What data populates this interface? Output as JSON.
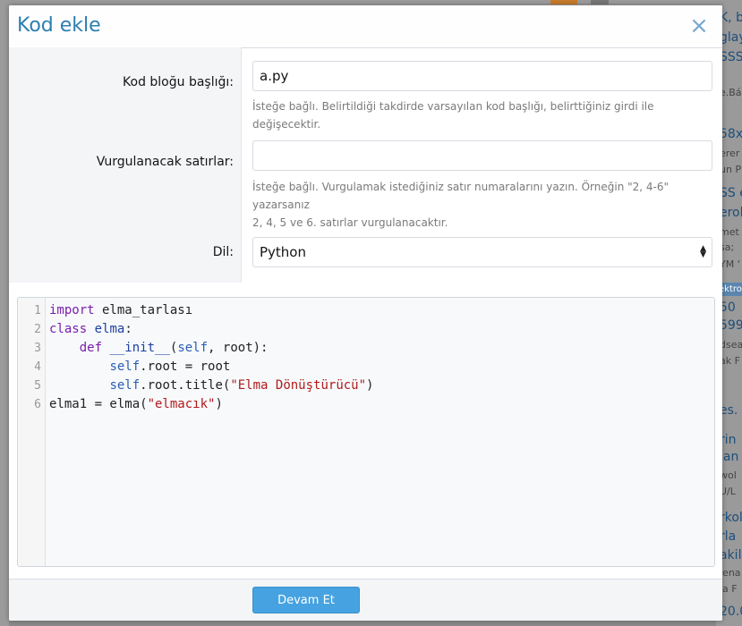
{
  "modal": {
    "title": "Kod ekle",
    "close_symbol": "×"
  },
  "form": {
    "title_label": "Kod bloğu başlığı:",
    "title_value": "a.py",
    "title_hint": "İsteğe bağlı. Belirtildiği takdirde varsayılan kod başlığı, belirttiğiniz girdi ile değişecektir.",
    "highlight_label": "Vurgulanacak satırlar:",
    "highlight_value": "",
    "highlight_hint_1": "İsteğe bağlı. Vurgulamak istediğiniz satır numaralarını yazın. Örneğin \"2, 4-6\" yazarsanız",
    "highlight_hint_2": "2, 4, 5 ve 6. satırlar vurgulanacaktır.",
    "language_label": "Dil:",
    "language_value": "Python"
  },
  "code": {
    "line_numbers": [
      "1",
      "2",
      "3",
      "4",
      "5",
      "6"
    ],
    "lines": [
      {
        "indent": "",
        "t1": "import",
        "t2": " elma_tarlası"
      },
      {
        "indent": "",
        "t1": "class",
        "t2": " ",
        "t3": "elma",
        "t4": ":"
      },
      {
        "indent": "    ",
        "t1": "def",
        "t2": " ",
        "t3": "__init__",
        "t4": "(",
        "t5": "self",
        "t6": ", root):"
      },
      {
        "indent": "        ",
        "t1": "self",
        "t2": ".root = root"
      },
      {
        "indent": "        ",
        "t1": "self",
        "t2": ".root.title(",
        "t3": "\"Elma Dönüştürücü\"",
        "t4": ")"
      },
      {
        "indent": "",
        "t1": "elma1 = elma(",
        "t2": "\"elmacık\"",
        "t3": ")"
      }
    ]
  },
  "footer": {
    "continue_label": "Devam Et"
  },
  "background": {
    "right_fragments": [
      "K, b",
      "glay",
      "SSS",
      "e.Bá",
      "58x",
      "erer",
      "un P",
      "SS e",
      "erol",
      "met",
      "sa;",
      "YM '",
      "ektro",
      "50",
      "599",
      "dsea",
      "ak F",
      "es.",
      "rin",
      "lan",
      "wol",
      "U/L",
      "rkol",
      "rla",
      "akil",
      "iena",
      "ia F",
      "20.0"
    ]
  },
  "colors": {
    "accent": "#2c7fb0",
    "button": "#46a2e0",
    "keyword": "#7a1fa8",
    "string": "#b21a1a"
  }
}
